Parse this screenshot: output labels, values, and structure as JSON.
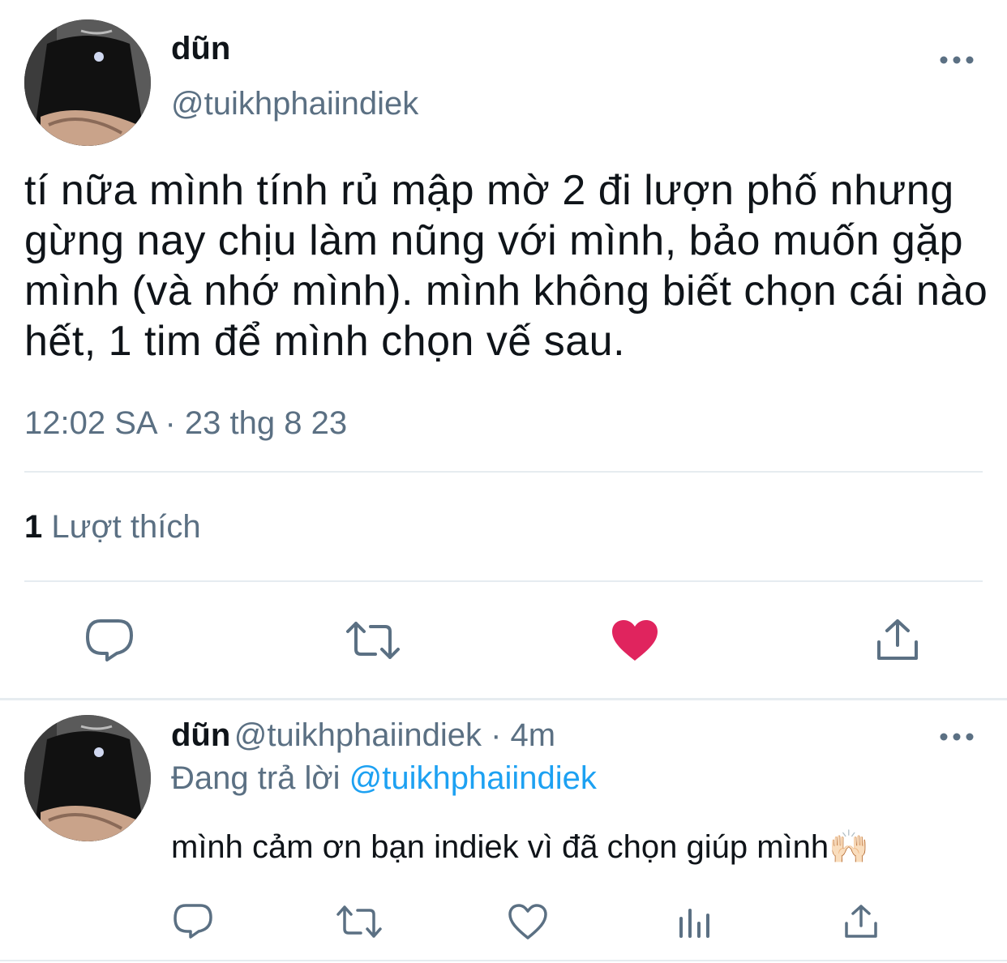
{
  "main_tweet": {
    "display_name": "dũn",
    "handle": "@tuikhphaiindiek",
    "text": "tí nữa mình tính rủ mập mờ 2 đi lượn phố nhưng gừng nay chịu làm nũng với mình, bảo muốn gặp mình (và nhớ mình). mình không biết chọn cái nào hết, 1 tim để mình chọn vế sau.",
    "timestamp": "12:02 SA · 23 thg 8 23",
    "likes_count": "1",
    "likes_label": "Lượt thích",
    "liked": true,
    "actions": [
      "reply-icon",
      "retweet-icon",
      "heart-filled-icon",
      "share-icon"
    ],
    "more_icon": "more-icon"
  },
  "reply_tweet": {
    "display_name": "dũn",
    "meta": "@tuikhphaiindiek · 4m",
    "replying_to_label": "Đang trả lời",
    "replying_to_handle": "@tuikhphaiindiek",
    "text": "mình cảm ơn bạn indiek vì đã chọn giúp mình",
    "emoji": "🙌🏻",
    "actions": [
      "reply-icon",
      "retweet-icon",
      "heart-icon",
      "analytics-icon",
      "share-icon"
    ],
    "more_icon": "more-icon"
  },
  "colors": {
    "text_primary": "#0f1419",
    "text_secondary": "#5b7083",
    "link": "#1da1f2",
    "like": "#e0245e",
    "divider": "#e6ecf0"
  }
}
